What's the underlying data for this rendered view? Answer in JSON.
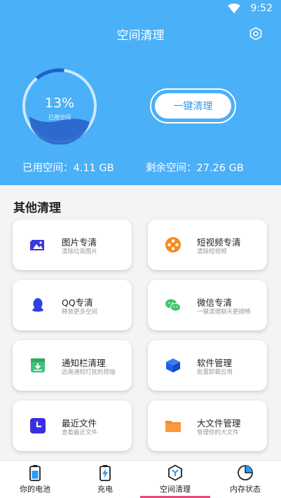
{
  "status": {
    "time": "9:52"
  },
  "header": {
    "title": "空间清理"
  },
  "gauge": {
    "percent_text": "13%",
    "label": "已用空间",
    "percent": 0.13
  },
  "actions": {
    "clean_label": "一键清理"
  },
  "storage": {
    "used": "已用空间：4.11 GB",
    "free": "剩余空间：27.26 GB"
  },
  "section": {
    "title": "其他清理"
  },
  "cards": [
    {
      "title": "图片专清",
      "subtitle": "清除垃圾图片",
      "icon": "image-icon",
      "color": "#3a3ad8"
    },
    {
      "title": "短视频专清",
      "subtitle": "清除短视频",
      "icon": "film-reel-icon",
      "color": "#f58a1f"
    },
    {
      "title": "QQ专清",
      "subtitle": "释放更多空间",
      "icon": "qq-icon",
      "color": "#2f42e0"
    },
    {
      "title": "微信专清",
      "subtitle": "一键清理聊天更顺畅",
      "icon": "wechat-icon",
      "color": "#3ec66a"
    },
    {
      "title": "通知栏清理",
      "subtitle": "远离通知打扰的烦恼",
      "icon": "notification-tray-icon",
      "color": "#3fc27a"
    },
    {
      "title": "软件管理",
      "subtitle": "批量卸载应用",
      "icon": "cube-icon",
      "color": "#1f5fe8"
    },
    {
      "title": "最近文件",
      "subtitle": "查看最近文件",
      "icon": "clock-icon",
      "color": "#3a2fe0"
    },
    {
      "title": "大文件管理",
      "subtitle": "管理你的大文件",
      "icon": "folder-icon",
      "color": "#f78a24"
    }
  ],
  "nav": [
    {
      "label": "你的电池",
      "icon": "battery-icon"
    },
    {
      "label": "充电",
      "icon": "charging-icon"
    },
    {
      "label": "空间清理",
      "icon": "clean-hex-icon",
      "active": true
    },
    {
      "label": "内存状态",
      "icon": "pie-chart-icon"
    }
  ]
}
